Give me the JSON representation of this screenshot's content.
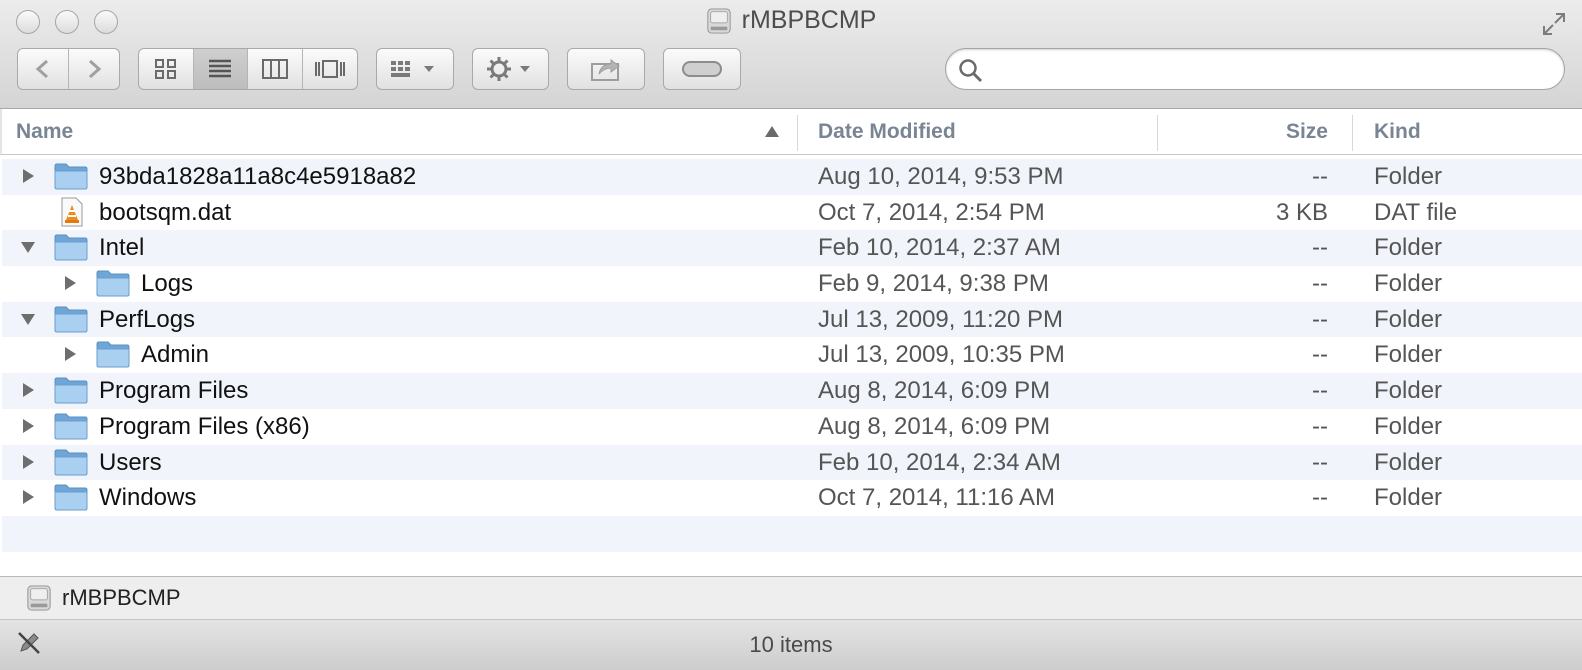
{
  "window": {
    "title": "rMBPBCMP"
  },
  "search": {
    "placeholder": "",
    "value": ""
  },
  "columns": {
    "name": "Name",
    "date": "Date Modified",
    "size": "Size",
    "kind": "Kind"
  },
  "rows": [
    {
      "name": "93bda1828a11a8c4e5918a82",
      "date": "Aug 10, 2014, 9:53 PM",
      "size": "--",
      "kind": "Folder"
    },
    {
      "name": "bootsqm.dat",
      "date": "Oct 7, 2014, 2:54 PM",
      "size": "3 KB",
      "kind": "DAT file"
    },
    {
      "name": "Intel",
      "date": "Feb 10, 2014, 2:37 AM",
      "size": "--",
      "kind": "Folder"
    },
    {
      "name": "Logs",
      "date": "Feb 9, 2014, 9:38 PM",
      "size": "--",
      "kind": "Folder"
    },
    {
      "name": "PerfLogs",
      "date": "Jul 13, 2009, 11:20 PM",
      "size": "--",
      "kind": "Folder"
    },
    {
      "name": "Admin",
      "date": "Jul 13, 2009, 10:35 PM",
      "size": "--",
      "kind": "Folder"
    },
    {
      "name": "Program Files",
      "date": "Aug 8, 2014, 6:09 PM",
      "size": "--",
      "kind": "Folder"
    },
    {
      "name": "Program Files (x86)",
      "date": "Aug 8, 2014, 6:09 PM",
      "size": "--",
      "kind": "Folder"
    },
    {
      "name": "Users",
      "date": "Feb 10, 2014, 2:34 AM",
      "size": "--",
      "kind": "Folder"
    },
    {
      "name": "Windows",
      "date": "Oct 7, 2014, 11:16 AM",
      "size": "--",
      "kind": "Folder"
    }
  ],
  "pathbar": {
    "label": "rMBPBCMP"
  },
  "status": {
    "text": "10 items"
  },
  "icons": {
    "back": "chevron-left-icon",
    "forward": "chevron-right-icon",
    "view_icons": "icon-view-icon",
    "view_list": "list-view-icon",
    "view_columns": "column-view-icon",
    "view_coverflow": "coverflow-view-icon",
    "arrange": "arrange-icon",
    "action": "gear-icon",
    "share": "share-icon",
    "tags": "tag-pill-icon",
    "search": "search-icon",
    "disk": "hard-disk-icon",
    "folder": "folder-icon",
    "vlc": "vlc-cone-icon"
  },
  "colors": {
    "stripe": "#f1f5fb",
    "header_text": "#7a8594",
    "folder": "#8fbde3"
  }
}
